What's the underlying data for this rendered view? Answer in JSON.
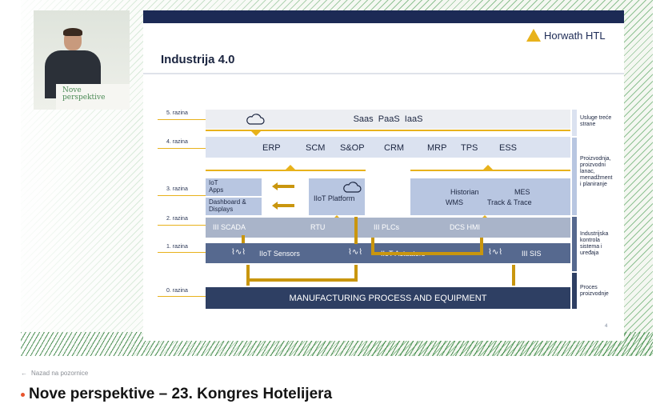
{
  "speaker": {
    "podium_text": "Nove\nperspektive",
    "podium_small": ""
  },
  "slide": {
    "logo": "Horwath HTL",
    "title": "Industrija 4.0",
    "page": "4",
    "levels": [
      "5. razina",
      "4. razina",
      "3. razina",
      "2. razina",
      "1. razina",
      "0. razina"
    ],
    "l5": "Saas  PaaS  IaaS",
    "l4": [
      "ERP",
      "SCM",
      "S&OP",
      "CRM",
      "MRP",
      "TPS",
      "ESS"
    ],
    "l3_left": [
      "IoT\nApps",
      "Dashboard &\nDisplays"
    ],
    "l3_platform": "IIoT Platform",
    "l3_right": [
      "Historian",
      "MES",
      "WMS",
      "Track & Trace"
    ],
    "l2": [
      "III SCADA",
      "RTU",
      "III PLCs",
      "DCS  HMI"
    ],
    "l1": [
      "IIoT Sensors",
      "IIoT Actuators",
      "III SIS"
    ],
    "l0": "MANUFACTURING PROCESS AND EQUIPMENT",
    "right": [
      "Usluge treće\nstrane",
      "Proizvodnja,\nproizvodni\nlanac,\nmenadžment\ni planiranje",
      "Industrijska\nkontrola\nsistema i\nuređaja",
      "Proces\nproizvodnje"
    ]
  },
  "back_link": "Nazad na pozornice",
  "page_title": "Nove perspektive – 23. Kongres Hotelijera",
  "colors": {
    "accent": "#e8552d",
    "gold": "#e8b21b",
    "navy": "#1c2a55"
  }
}
